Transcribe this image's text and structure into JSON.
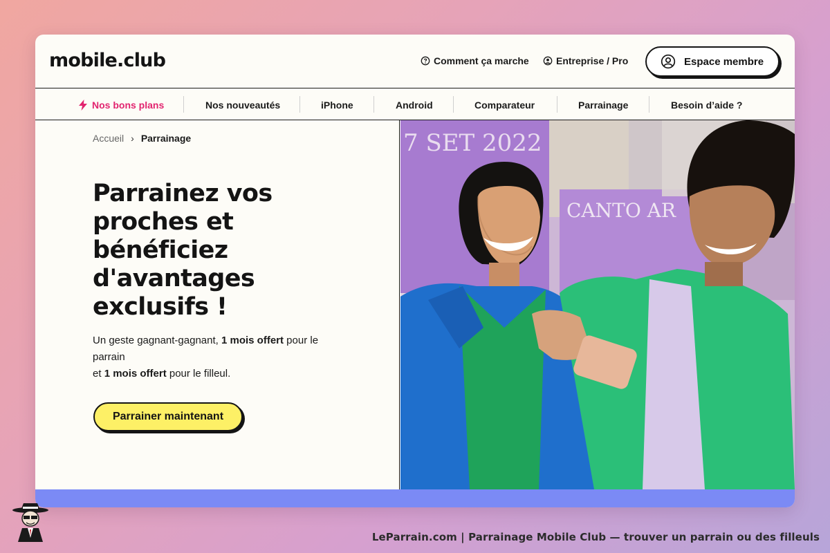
{
  "header": {
    "logo": "mobile.club",
    "links": [
      {
        "label": "Comment ça marche",
        "icon": "question-circle-icon"
      },
      {
        "label": "Entreprise / Pro",
        "icon": "user-circle-icon"
      }
    ],
    "member_button": {
      "label": "Espace membre",
      "icon": "user-circle-icon"
    }
  },
  "nav": {
    "items": [
      {
        "label": "Nos bons plans",
        "icon": "lightning-icon"
      },
      {
        "label": "Nos nouveautés"
      },
      {
        "label": "iPhone"
      },
      {
        "label": "Android"
      },
      {
        "label": "Comparateur"
      },
      {
        "label": "Parrainage"
      },
      {
        "label": "Besoin d’aide ?"
      }
    ]
  },
  "breadcrumb": {
    "home": "Accueil",
    "separator": "›",
    "current": "Parrainage"
  },
  "hero": {
    "headline": "Parrainez vos proches et bénéficiez d'avantages exclusifs !",
    "sub_part1": "Un geste gagnant-gagnant, ",
    "sub_bold1": "1 mois offert",
    "sub_part2": " pour le parrain",
    "sub_part3": "et ",
    "sub_bold2": "1 mois offert",
    "sub_part4": " pour le filleul.",
    "cta": "Parrainer maintenant",
    "poster_text_1": "7 SET 2022",
    "poster_text_2": "CANTO AR"
  },
  "caption": "LeParrain.com | Parrainage Mobile Club — trouver un parrain ou des filleuls",
  "colors": {
    "accent_pink": "#e2246f",
    "cta_yellow": "#fdf066",
    "footer_band": "#7b8af5",
    "page_bg": "#fdfcf7"
  }
}
